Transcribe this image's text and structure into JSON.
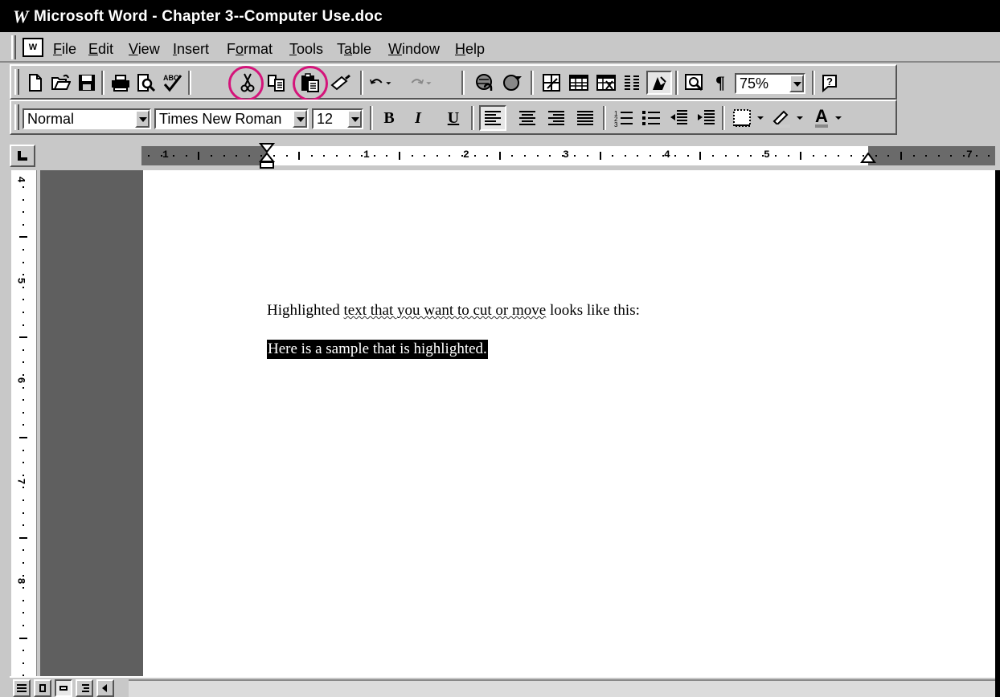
{
  "window": {
    "logo": "W",
    "title": "Microsoft Word - Chapter 3--Computer Use.doc"
  },
  "menu": {
    "items": [
      {
        "label": "File",
        "accel": "F",
        "rest": "ile"
      },
      {
        "label": "Edit",
        "accel": "E",
        "rest": "dit"
      },
      {
        "label": "View",
        "accel": "V",
        "rest": "iew"
      },
      {
        "label": "Insert",
        "accel": "I",
        "rest": "nsert"
      },
      {
        "label": "Format",
        "pre": "F",
        "accel": "o",
        "rest": "rmat"
      },
      {
        "label": "Tools",
        "accel": "T",
        "rest": "ools"
      },
      {
        "label": "Table",
        "pre": "T",
        "accel": "a",
        "rest": "ble"
      },
      {
        "label": "Window",
        "accel": "W",
        "rest": "indow"
      },
      {
        "label": "Help",
        "accel": "H",
        "rest": "elp"
      }
    ]
  },
  "standard_toolbar": {
    "buttons": [
      "new-icon",
      "open-icon",
      "save-icon",
      "print-icon",
      "print-preview-icon",
      "spelling-icon",
      "cut-icon",
      "copy-icon",
      "paste-icon",
      "format-painter-icon",
      "undo-icon",
      "redo-icon",
      "hyperlink-icon",
      "web-toolbar-icon",
      "tables-borders-icon",
      "insert-table-icon",
      "insert-excel-icon",
      "columns-icon",
      "drawing-icon",
      "document-map-icon",
      "show-hide-icon",
      "help-icon"
    ],
    "zoom": "75%",
    "highlighted_buttons": [
      "cut-icon",
      "paste-icon"
    ],
    "highlight_color": "#d4147a"
  },
  "formatting_toolbar": {
    "style": "Normal",
    "font": "Times New Roman",
    "size": "12",
    "bold": "B",
    "italic": "I",
    "underline": "U",
    "font_color_letter": "A"
  },
  "ruler": {
    "horizontal_labels": [
      "1",
      "1",
      "2",
      "3",
      "4",
      "5",
      "7"
    ],
    "vertical_labels": [
      "4",
      "5",
      "6",
      "7",
      "8"
    ]
  },
  "document": {
    "line1_parts": [
      {
        "text": "Highlighted ",
        "squiggle": false
      },
      {
        "text": "text that you want to cut or move",
        "squiggle": true
      },
      {
        "text": " looks like this:",
        "squiggle": false
      }
    ],
    "line2_highlighted": "Here is a sample that is highlighted."
  }
}
